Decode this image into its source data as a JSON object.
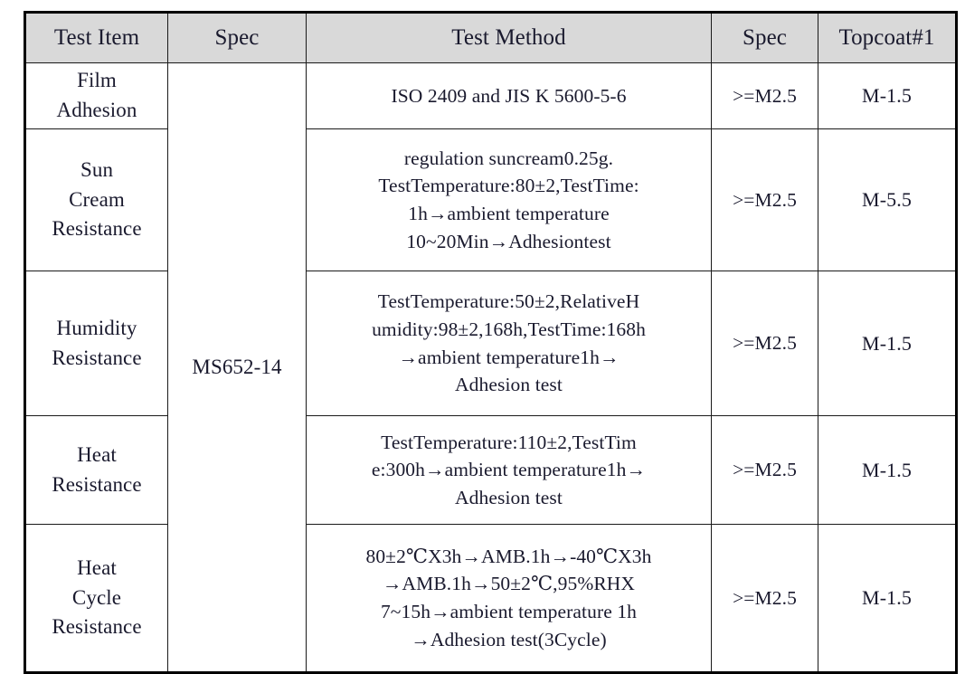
{
  "table": {
    "headers": [
      {
        "label": "Test Item"
      },
      {
        "label": "Spec"
      },
      {
        "label": "Test Method"
      },
      {
        "label": "Spec"
      },
      {
        "label": "Topcoat#1"
      }
    ],
    "merged_spec": "MS652-14",
    "rows": [
      {
        "test_item_lines": [
          "Film",
          "Adhesion"
        ],
        "test_method_lines": [
          "ISO  2409 and JIS K 5600-5-6"
        ],
        "spec": ">=M2.5",
        "topcoat": "M-1.5"
      },
      {
        "test_item_lines": [
          "Sun",
          "Cream",
          "Resistance"
        ],
        "test_method_lines": [
          "regulation suncream0.25g.",
          "TestTemperature:80±2,TestTime:",
          "1h→ambient temperature",
          "10~20Min→Adhesiontest"
        ],
        "spec": ">=M2.5",
        "topcoat": "M-5.5"
      },
      {
        "test_item_lines": [
          "Humidity",
          "Resistance"
        ],
        "test_method_lines": [
          "TestTemperature:50±2,RelativeH",
          "umidity:98±2,168h,TestTime:168h",
          "→ambient temperature1h→",
          "Adhesion test"
        ],
        "spec": ">=M2.5",
        "topcoat": "M-1.5"
      },
      {
        "test_item_lines": [
          "Heat",
          "Resistance"
        ],
        "test_method_lines": [
          "TestTemperature:110±2,TestTim",
          "e:300h→ambient temperature1h→",
          "Adhesion test"
        ],
        "spec": ">=M2.5",
        "topcoat": "M-1.5"
      },
      {
        "test_item_lines": [
          "Heat",
          "Cycle",
          "Resistance"
        ],
        "test_method_lines": [
          "80±2℃X3h→AMB.1h→-40℃X3h",
          "→AMB.1h→50±2℃,95%RHX",
          "7~15h→ambient temperature 1h",
          "→Adhesion test(3Cycle)"
        ],
        "spec": ">=M2.5",
        "topcoat": "M-1.5"
      }
    ]
  },
  "colors": {
    "header_background": "#d9d9d9",
    "border": "#1a1a1a",
    "outer_border": "#000000",
    "text": "#1a1a2e",
    "cell_background": "#ffffff"
  }
}
